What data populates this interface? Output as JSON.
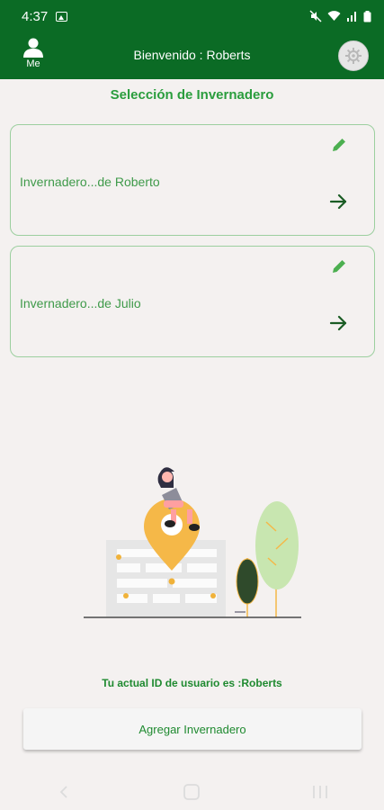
{
  "status_bar": {
    "time": "4:37"
  },
  "app_bar": {
    "me_label": "Me",
    "title": "Bienvenido : Roberts"
  },
  "section_title": "Selección de Invernadero",
  "greenhouses": [
    {
      "name": "Invernadero...de Roberto"
    },
    {
      "name": "Invernadero...de Julio"
    }
  ],
  "user_id_text": "Tu actual ID de usuario es  :Roberts",
  "add_button_label": "Agregar Invernadero",
  "colors": {
    "primary": "#0b6b25",
    "accent_text": "#2a9d3d",
    "card_border": "#9ccf9f",
    "background": "#f4f1f0"
  }
}
